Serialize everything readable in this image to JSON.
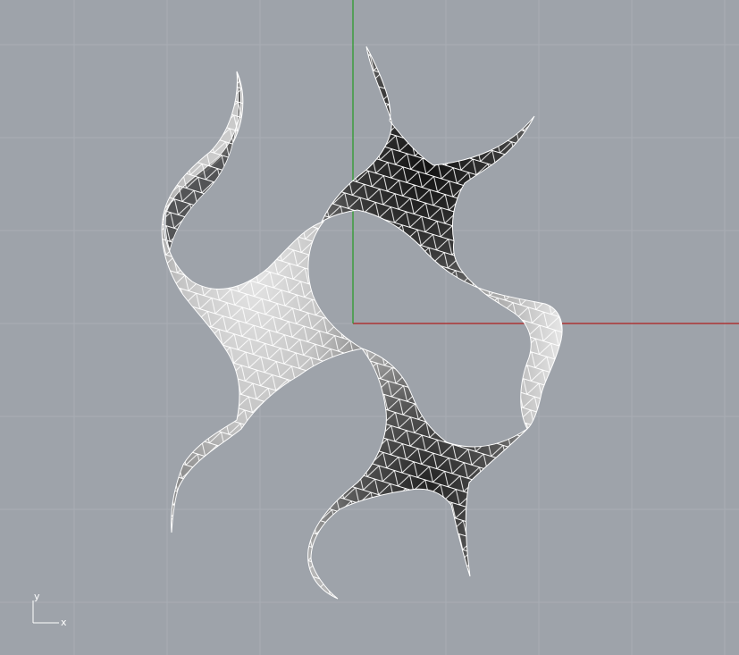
{
  "viewport": {
    "colors": {
      "background": "#9ea3aa",
      "grid_line": "#a9aeb4",
      "x_axis": "#b01f1f",
      "y_axis": "#2e9b2e",
      "mesh_wire": "#ffffff"
    }
  },
  "axis_widget": {
    "x_label": "x",
    "y_label": "y"
  },
  "model": {
    "lobes": 4
  }
}
